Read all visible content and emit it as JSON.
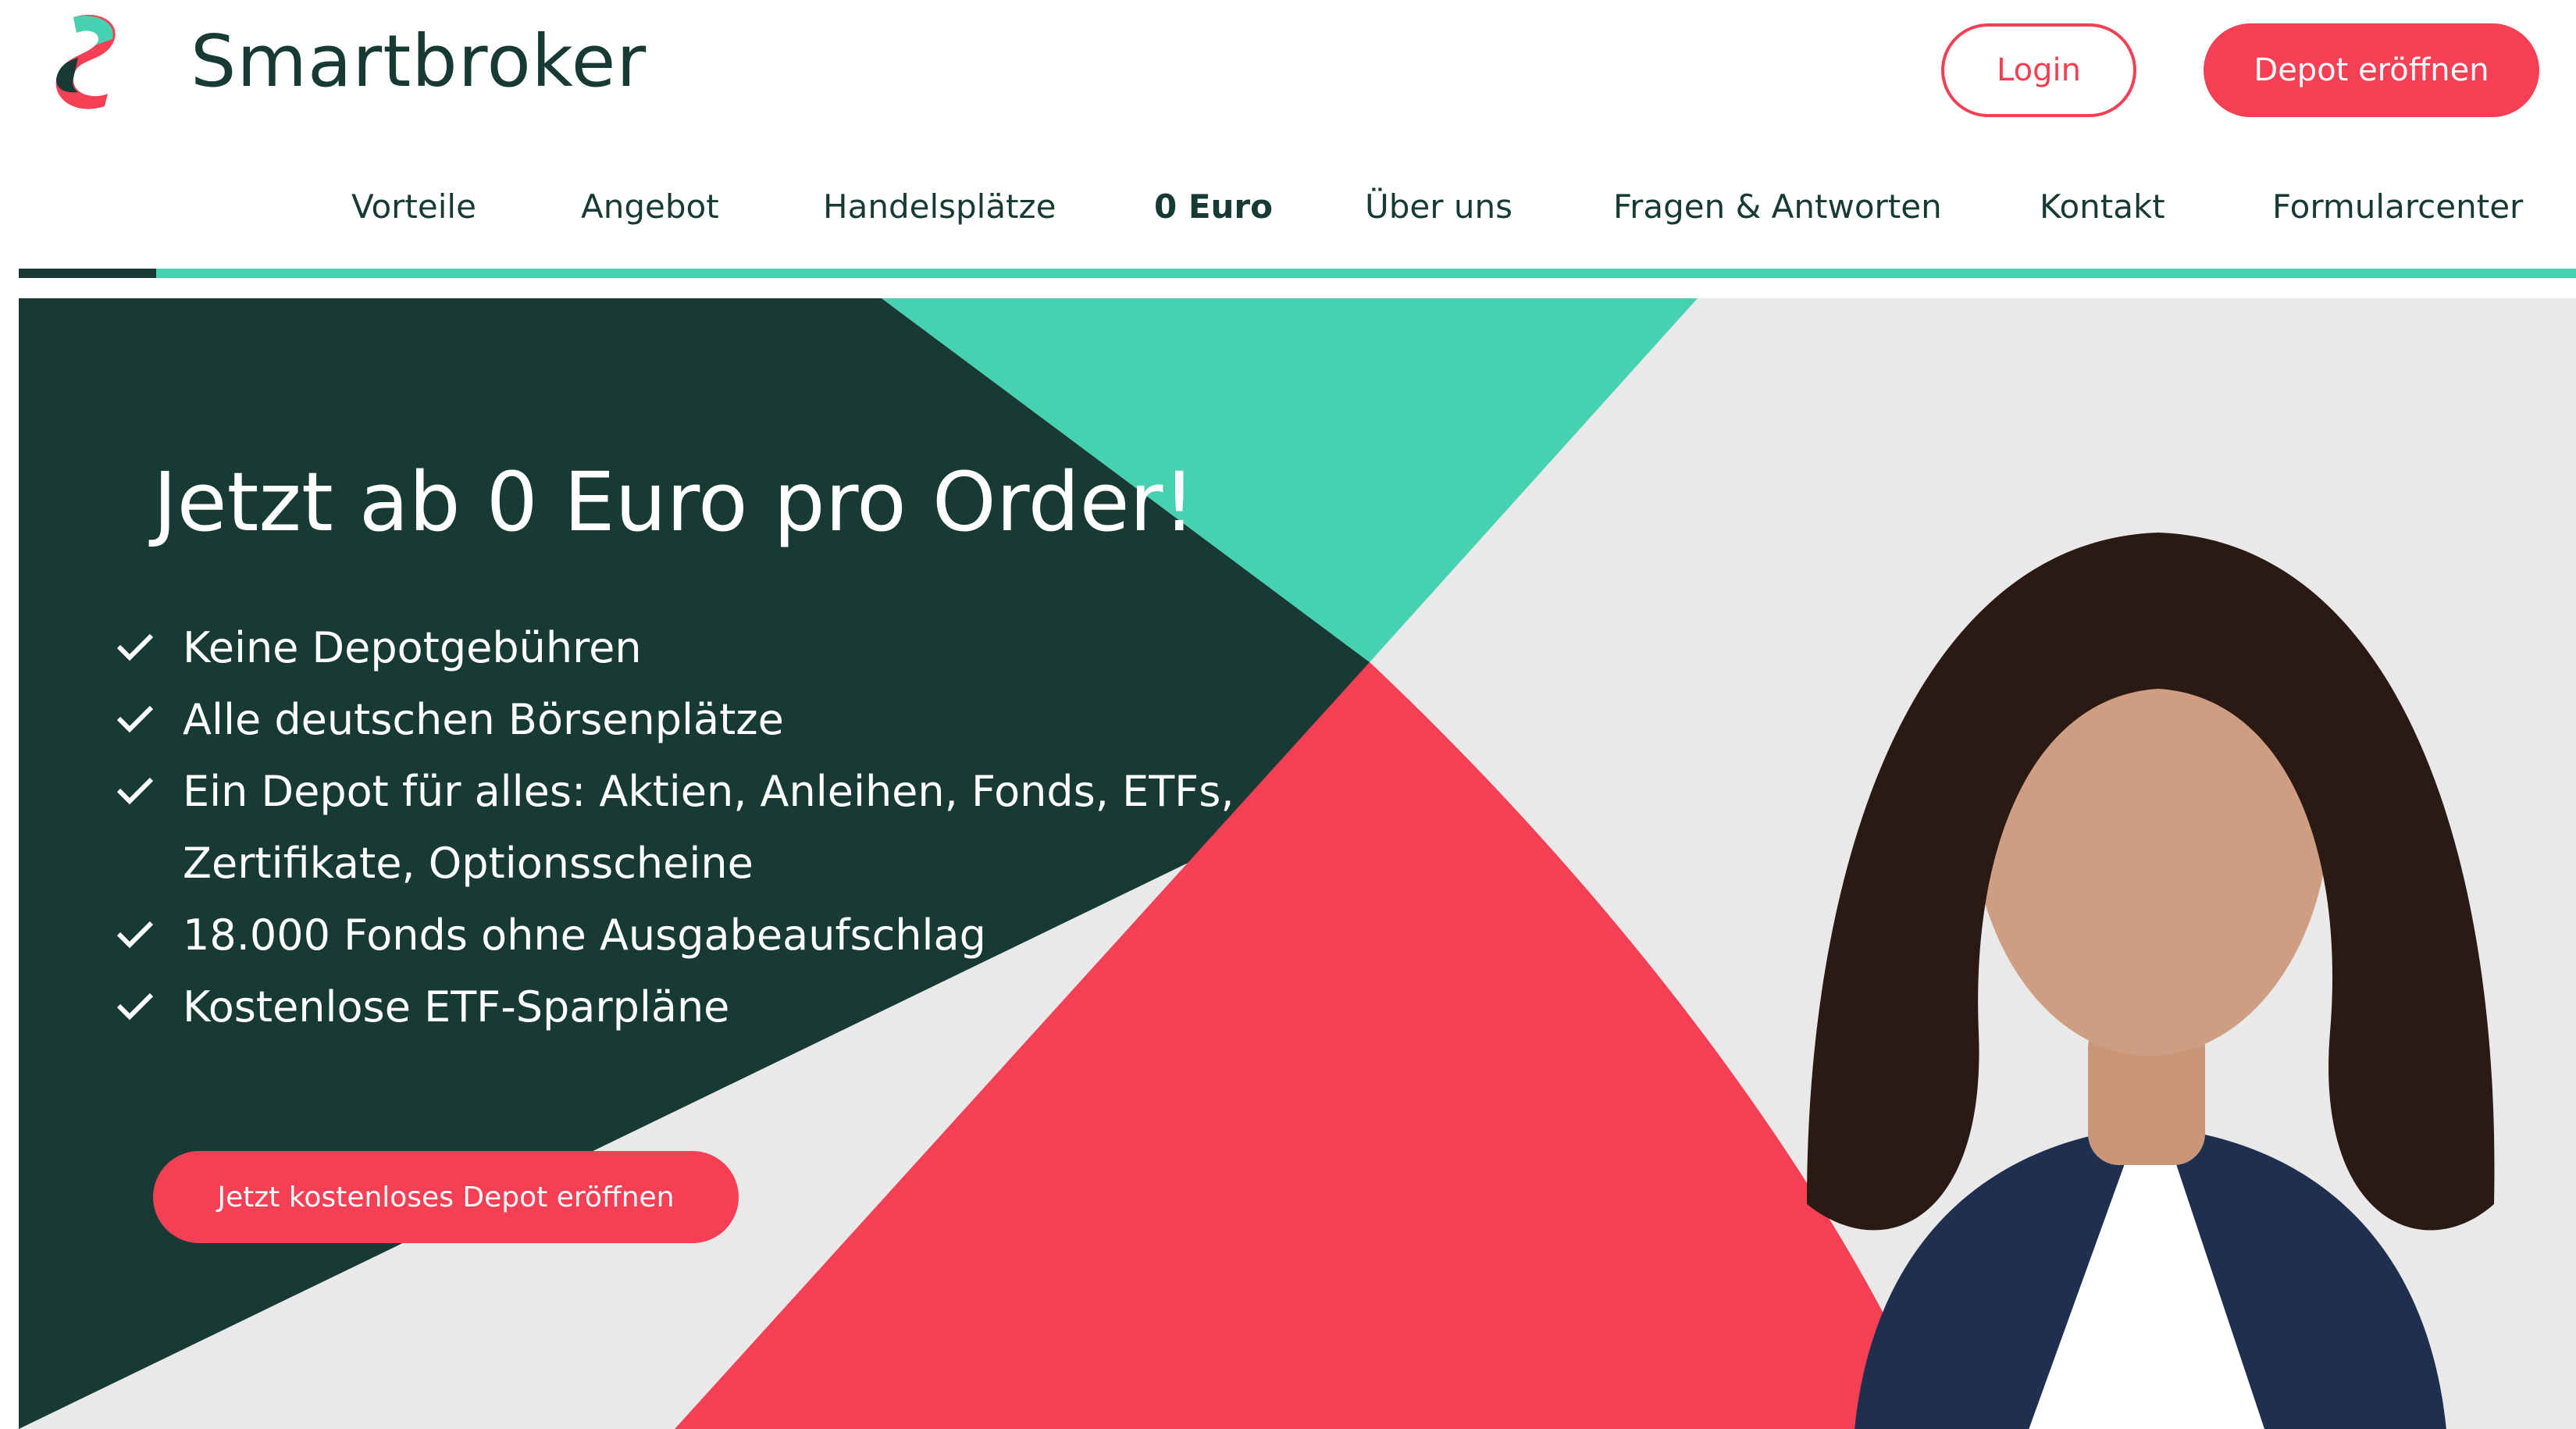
{
  "brand": {
    "name": "Smartbroker",
    "colors": {
      "primary": "#f43f54",
      "dark": "#173a34",
      "mint": "#46d2b0",
      "light_bg": "#e9e9ea"
    }
  },
  "header": {
    "login_label": "Login",
    "open_depot_label": "Depot eröffnen"
  },
  "nav": {
    "items": [
      {
        "label": "Vorteile",
        "active": false
      },
      {
        "label": "Angebot",
        "active": false
      },
      {
        "label": "Handelsplätze",
        "active": false
      },
      {
        "label": "0 Euro",
        "active": true
      },
      {
        "label": "Über uns",
        "active": false
      },
      {
        "label": "Fragen & Antworten",
        "active": false
      },
      {
        "label": "Kontakt",
        "active": false
      },
      {
        "label": "Formularcenter",
        "active": false
      }
    ]
  },
  "hero": {
    "title": "Jetzt ab 0 Euro pro Order!",
    "features": [
      "Keine Depotgebühren",
      "Alle deutschen Börsenplätze",
      "Ein Depot für alles: Aktien, Anleihen, Fonds, ETFs,",
      "Zertifikate, Optionsscheine",
      "18.000 Fonds ohne Ausgabeaufschlag",
      "Kostenlose ETF-Sparpläne"
    ],
    "cta_label": "Jetzt kostenloses Depot eröffnen",
    "image": "portrait-photo"
  }
}
